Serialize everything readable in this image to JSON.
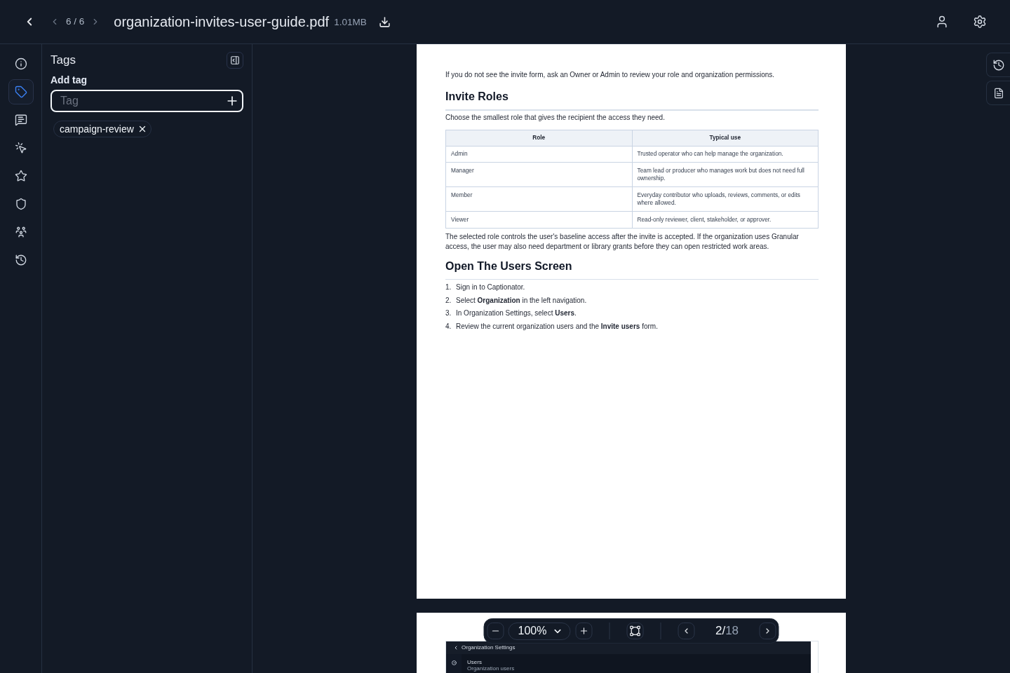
{
  "top_bar": {
    "page_position": "6 / 6",
    "file_name": "organization-invites-user-guide.pdf",
    "file_size": "1.01MB"
  },
  "rail": {
    "items": [
      {
        "selected": false
      },
      {
        "selected": true
      },
      {
        "selected": false
      },
      {
        "selected": false
      },
      {
        "selected": false
      },
      {
        "selected": false
      },
      {
        "selected": false
      },
      {
        "selected": false
      }
    ]
  },
  "tags_panel": {
    "title": "Tags",
    "add_label": "Add tag",
    "input": {
      "placeholder": "Tag"
    },
    "tags": [
      {
        "label": "campaign-review"
      }
    ]
  },
  "document": {
    "page_1": {
      "blocks": [
        {
          "kind": "paragraph",
          "text": "If you do not see the invite form, ask an Owner or Admin to review your role and organization permissions."
        },
        {
          "kind": "heading",
          "text": "Invite Roles"
        },
        {
          "kind": "paragraph",
          "text": "Choose the smallest role that gives the recipient the access they need."
        },
        {
          "kind": "table",
          "columns": [
            "Role",
            "Typical use"
          ],
          "rows": [
            [
              "Admin",
              "Trusted operator who can help manage the organization."
            ],
            [
              "Manager",
              "Team lead or producer who manages work but does not need full ownership."
            ],
            [
              "Member",
              "Everyday contributor who uploads, reviews, comments, or edits where allowed."
            ],
            [
              "Viewer",
              "Read-only reviewer, client, stakeholder, or approver."
            ]
          ]
        },
        {
          "kind": "paragraph",
          "text": "The selected role controls the user's baseline access after the invite is accepted. If the organization uses Granular access, the user may also need department or library grants before they can open restricted work areas."
        },
        {
          "kind": "heading",
          "text": "Open The Users Screen"
        },
        {
          "kind": "list",
          "items": [
            {
              "number": "1.",
              "text": "Sign in to Captionator."
            },
            {
              "number": "2.",
              "text": "Select **Organization** in the left navigation."
            },
            {
              "number": "3.",
              "text": "In Organization Settings, select **Users**."
            },
            {
              "number": "4.",
              "text": "Review the current organization users and the **Invite users** form."
            }
          ]
        }
      ]
    },
    "page_2": {
      "screenshot": {
        "header": "Organization Settings",
        "nav_title": "Users",
        "nav_subtitle": "Organization users"
      }
    }
  },
  "viewer_toolbar": {
    "zoom": "100%",
    "page": {
      "current": "2",
      "separator": "/",
      "total": "18"
    }
  }
}
